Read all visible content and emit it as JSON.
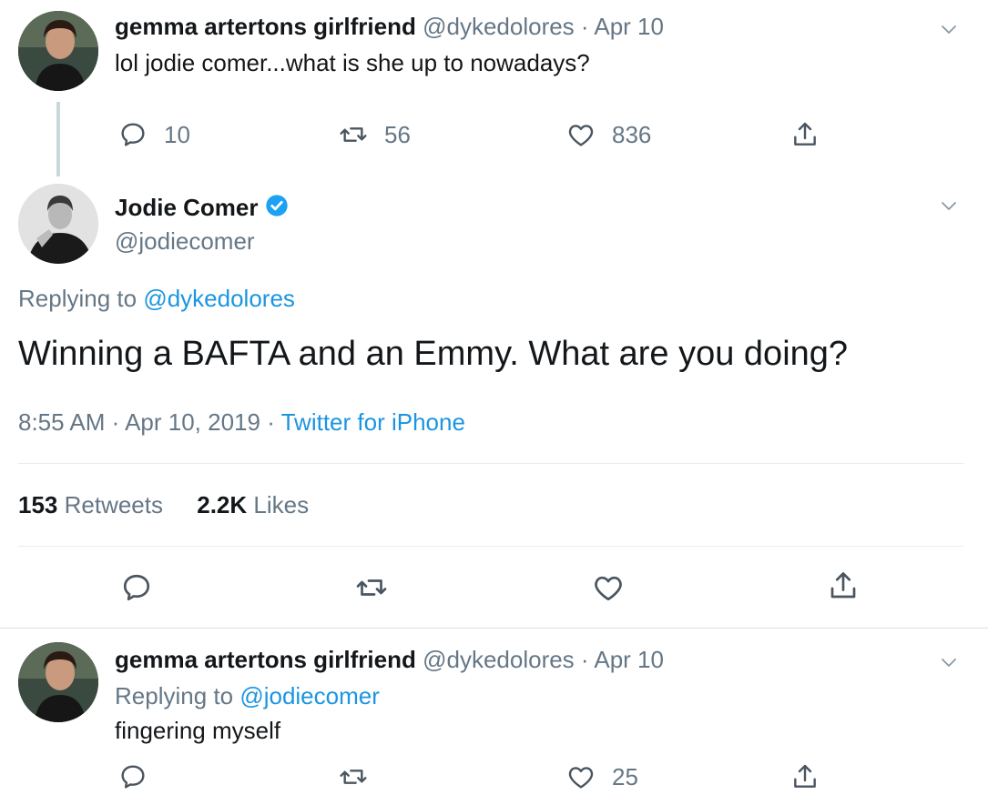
{
  "tweet1": {
    "display_name": "gemma artertons girlfriend",
    "handle": "@dykedolores",
    "separator": " · ",
    "date": "Apr 10",
    "text": "lol jodie comer...what is she up to nowadays?",
    "replies": "10",
    "retweets": "56",
    "likes": "836"
  },
  "main_tweet": {
    "display_name": "Jodie Comer",
    "handle": "@jodiecomer",
    "replying_prefix": "Replying to ",
    "replying_to": "@dykedolores",
    "text": "Winning a BAFTA and an Emmy. What are you doing?",
    "time": "8:55 AM",
    "sep1": " · ",
    "date": "Apr 10, 2019",
    "sep2": " · ",
    "source": "Twitter for iPhone",
    "retweet_count": "153",
    "retweet_label": " Retweets",
    "like_count": "2.2K",
    "like_label": " Likes"
  },
  "tweet3": {
    "display_name": "gemma artertons girlfriend",
    "handle": "@dykedolores",
    "separator": " · ",
    "date": "Apr 10",
    "replying_prefix": "Replying to ",
    "replying_to": "@jodiecomer",
    "text": "fingering myself",
    "likes": "25"
  },
  "icons": {
    "reply": "reply-icon",
    "retweet": "retweet-icon",
    "like": "heart-icon",
    "share": "share-icon",
    "more": "chevron-down-icon",
    "verified": "verified-badge-icon"
  },
  "colors": {
    "link": "#1b95e0",
    "muted": "#657786",
    "text": "#14171a",
    "verified": "#1da1f2"
  }
}
